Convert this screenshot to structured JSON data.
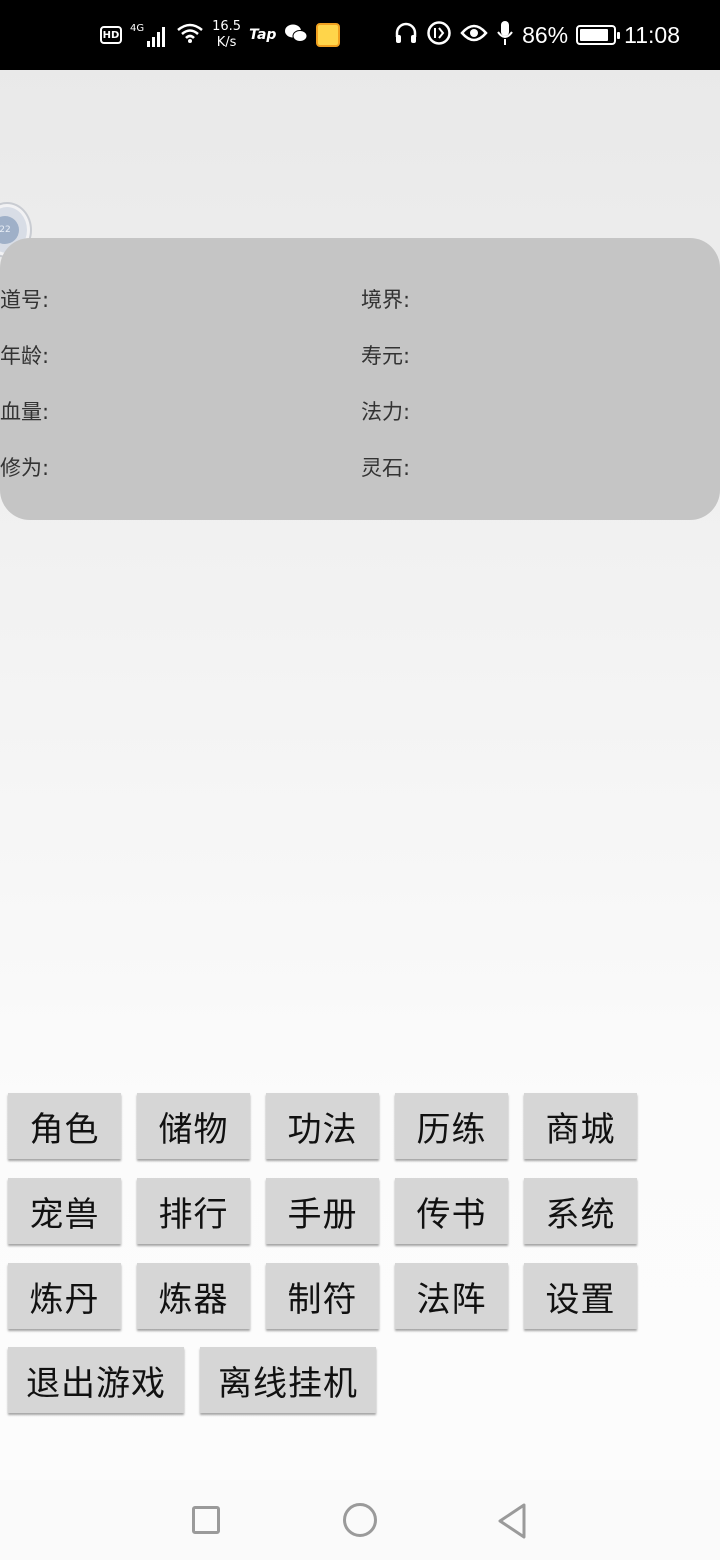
{
  "status_bar": {
    "hd": "HD",
    "signal": "4G",
    "net_speed_value": "16.5",
    "net_speed_unit": "K/s",
    "tap": "Tap",
    "battery_pct": "86%",
    "time": "11:08",
    "icons": [
      "signal-icon",
      "wifi-icon",
      "wechat-icon",
      "app-icon",
      "headphones-icon",
      "data-saver-icon",
      "eye-icon",
      "mic-icon",
      "battery-icon"
    ]
  },
  "avatar": {
    "text": "22"
  },
  "info": {
    "dao_hao": "道号:",
    "jing_jie": "境界:",
    "nian_ling": "年龄:",
    "shou_yuan": "寿元:",
    "xue_liang": "血量:",
    "fa_li": "法力:",
    "xiu_wei": "修为:",
    "ling_shi": "灵石:"
  },
  "buttons": {
    "jue_se": "角色",
    "chu_wu": "储物",
    "gong_fa": "功法",
    "li_lian": "历练",
    "shang_cheng": "商城",
    "chong_shou": "宠兽",
    "pai_hang": "排行",
    "shou_ce": "手册",
    "chuan_shu": "传书",
    "xi_tong": "系统",
    "lian_dan": "炼丹",
    "lian_qi": "炼器",
    "zhi_fu": "制符",
    "fa_zhen": "法阵",
    "she_zhi": "设置",
    "tui_chu": "退出游戏",
    "li_xian": "离线挂机"
  },
  "nav_bar": {
    "icons": [
      "recent-apps-icon",
      "home-icon",
      "back-icon"
    ]
  }
}
